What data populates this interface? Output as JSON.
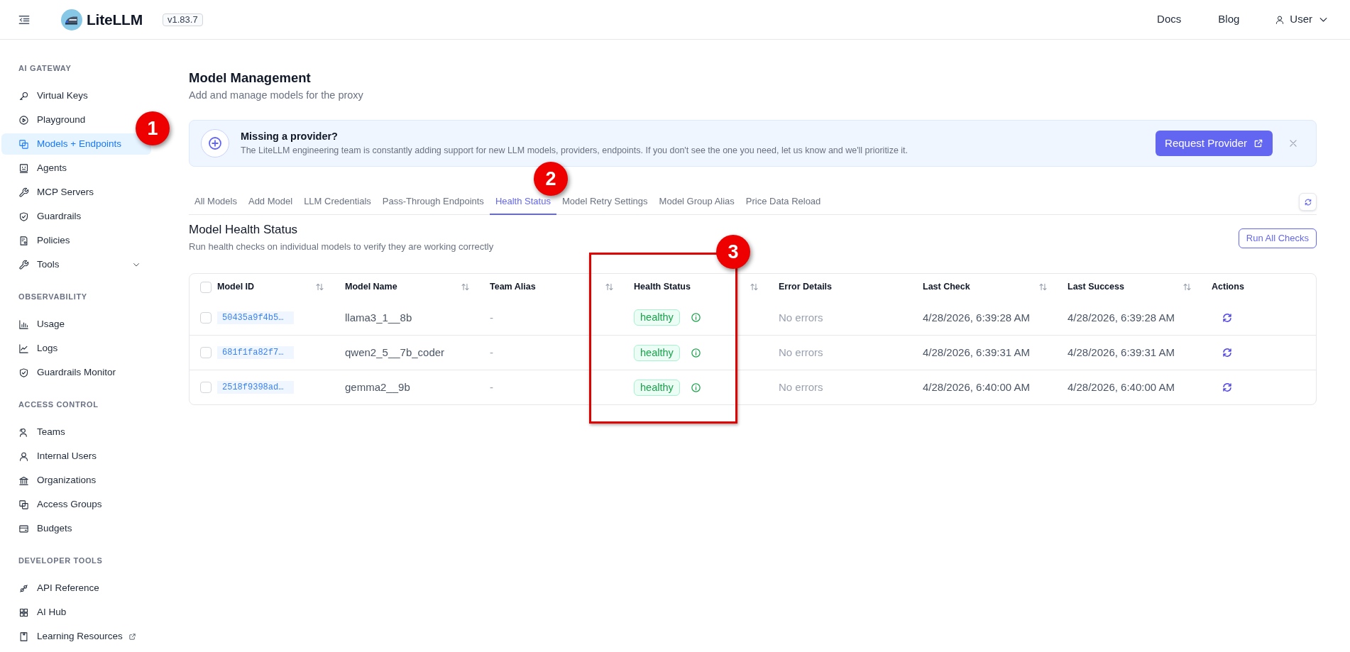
{
  "top_bar": {
    "brand": "LiteLLM",
    "version": "v1.83.7",
    "links": [
      "Docs",
      "Blog"
    ],
    "user": "User"
  },
  "sidebar": {
    "sections": [
      {
        "title": "AI GATEWAY",
        "items": [
          {
            "label": "Virtual Keys",
            "kind": "page",
            "selected": false
          },
          {
            "label": "Playground",
            "kind": "page",
            "selected": false
          },
          {
            "label": "Models + Endpoints",
            "kind": "page",
            "selected": true
          },
          {
            "label": "Agents",
            "kind": "page",
            "selected": false
          },
          {
            "label": "MCP Servers",
            "kind": "page",
            "selected": false
          },
          {
            "label": "Guardrails",
            "kind": "page",
            "selected": false
          },
          {
            "label": "Policies",
            "kind": "page",
            "selected": false
          },
          {
            "label": "Tools",
            "kind": "submenu",
            "expanded": false,
            "selected": false
          }
        ]
      },
      {
        "title": "OBSERVABILITY",
        "items": [
          {
            "label": "Usage",
            "kind": "page",
            "selected": false
          },
          {
            "label": "Logs",
            "kind": "page",
            "selected": false
          },
          {
            "label": "Guardrails Monitor",
            "kind": "page",
            "selected": false
          }
        ]
      },
      {
        "title": "ACCESS CONTROL",
        "items": [
          {
            "label": "Teams",
            "kind": "page",
            "selected": false
          },
          {
            "label": "Internal Users",
            "kind": "page",
            "selected": false
          },
          {
            "label": "Organizations",
            "kind": "page",
            "selected": false
          },
          {
            "label": "Access Groups",
            "kind": "page",
            "selected": false
          },
          {
            "label": "Budgets",
            "kind": "page",
            "selected": false
          }
        ]
      },
      {
        "title": "DEVELOPER TOOLS",
        "items": [
          {
            "label": "API Reference",
            "kind": "page",
            "selected": false
          },
          {
            "label": "AI Hub",
            "kind": "page",
            "selected": false
          },
          {
            "label": "Learning Resources",
            "kind": "external",
            "selected": false
          }
        ]
      }
    ]
  },
  "page": {
    "title": "Model Management",
    "subtitle": "Add and manage models for the proxy"
  },
  "banner": {
    "title": "Missing a provider?",
    "text": "The LiteLLM engineering team is constantly adding support for new LLM models, providers, endpoints. If you don't see the one you need, let us know and we'll prioritize it.",
    "button": "Request Provider"
  },
  "tabs": [
    {
      "label": "All Models",
      "selected": false
    },
    {
      "label": "Add Model",
      "selected": false
    },
    {
      "label": "LLM Credentials",
      "selected": false
    },
    {
      "label": "Pass-Through Endpoints",
      "selected": false
    },
    {
      "label": "Health Status",
      "selected": true
    },
    {
      "label": "Model Retry Settings",
      "selected": false
    },
    {
      "label": "Model Group Alias",
      "selected": false
    },
    {
      "label": "Price Data Reload",
      "selected": false
    }
  ],
  "health_section": {
    "title": "Model Health Status",
    "description": "Run health checks on individual models to verify they are working correctly",
    "button": "Run All Checks"
  },
  "table": {
    "all_checked": false,
    "columns": [
      {
        "label": "Model ID",
        "sortable": true
      },
      {
        "label": "Model Name",
        "sortable": true
      },
      {
        "label": "Team Alias",
        "sortable": true
      },
      {
        "label": "Health Status",
        "sortable": true
      },
      {
        "label": "Error Details",
        "sortable": false
      },
      {
        "label": "Last Check",
        "sortable": true
      },
      {
        "label": "Last Success",
        "sortable": true
      },
      {
        "label": "Actions",
        "sortable": false
      }
    ],
    "rows": [
      {
        "checked": false,
        "model_id": "50435a9f4b5…",
        "model_name": "llama3_1__8b",
        "team_alias": "-",
        "health_status": "healthy",
        "healthy": true,
        "error_details": "No errors",
        "last_check": "4/28/2026, 6:39:28 AM",
        "last_success": "4/28/2026, 6:39:28 AM"
      },
      {
        "checked": false,
        "model_id": "681f1fa82f7…",
        "model_name": "qwen2_5__7b_coder",
        "team_alias": "-",
        "health_status": "healthy",
        "healthy": true,
        "error_details": "No errors",
        "last_check": "4/28/2026, 6:39:31 AM",
        "last_success": "4/28/2026, 6:39:31 AM"
      },
      {
        "checked": false,
        "model_id": "2518f9398ad…",
        "model_name": "gemma2__9b",
        "team_alias": "-",
        "health_status": "healthy",
        "healthy": true,
        "error_details": "No errors",
        "last_check": "4/28/2026, 6:40:00 AM",
        "last_success": "4/28/2026, 6:40:00 AM"
      }
    ]
  },
  "annotations": {
    "markers": [
      "1",
      "2",
      "3"
    ],
    "highlight_box": true
  }
}
